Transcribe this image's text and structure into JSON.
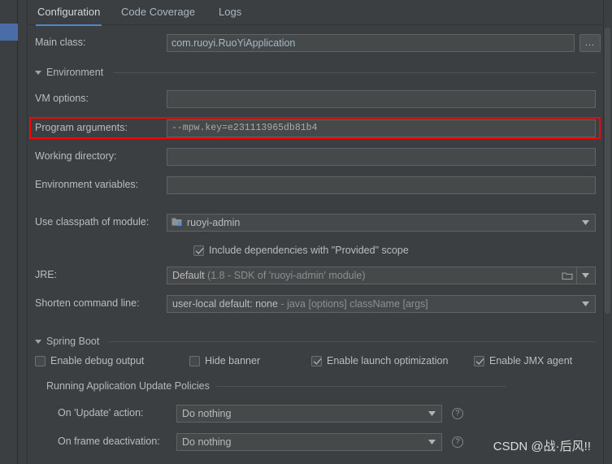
{
  "window": {
    "background": "#3c3f41",
    "accent": "#4a88c7",
    "highlight_color": "#ff0000"
  },
  "tabs": [
    {
      "label": "Configuration",
      "active": true
    },
    {
      "label": "Code Coverage",
      "active": false
    },
    {
      "label": "Logs",
      "active": false
    }
  ],
  "fields": {
    "main_class": {
      "label": "Main class:",
      "value": "com.ruoyi.RuoYiApplication",
      "browse_label": "..."
    },
    "vm_options": {
      "label": "VM options:",
      "value": "",
      "icons": [
        "plus-icon",
        "expand-icon"
      ]
    },
    "program_arguments": {
      "label": "Program arguments:",
      "value": "--mpw.key=e231113965db81b4",
      "icons": [
        "plus-icon",
        "expand-icon"
      ],
      "highlighted": true
    },
    "working_directory": {
      "label": "Working directory:",
      "value": "",
      "icons": [
        "plus-icon",
        "folder-icon"
      ]
    },
    "environment_variables": {
      "label": "Environment variables:",
      "value": "",
      "icons": [
        "list-icon"
      ]
    },
    "use_classpath_of_module": {
      "label": "Use classpath of module:",
      "value": "ruoyi-admin",
      "icon": "module-icon"
    },
    "jre": {
      "label": "JRE:",
      "value": "Default",
      "value_hint": "(1.8 - SDK of 'ruoyi-admin' module)"
    },
    "shorten_command_line": {
      "label": "Shorten command line:",
      "value": "user-local default: none",
      "value_hint": "- java [options] className [args]"
    }
  },
  "sections": {
    "environment": {
      "label": "Environment",
      "expanded": true
    },
    "spring_boot": {
      "label": "Spring Boot",
      "expanded": true
    },
    "running_application_update_policies": {
      "label": "Running Application Update Policies"
    }
  },
  "checkboxes": {
    "include_provided_scope": {
      "label": "Include dependencies with \"Provided\" scope",
      "checked": true
    },
    "enable_debug_output": {
      "label": "Enable debug output",
      "checked": false
    },
    "hide_banner": {
      "label": "Hide banner",
      "checked": false
    },
    "enable_launch_optimization": {
      "label": "Enable launch optimization",
      "checked": true
    },
    "enable_jmx_agent": {
      "label": "Enable JMX agent",
      "checked": true
    }
  },
  "update_policies": {
    "on_update_action": {
      "label": "On 'Update' action:",
      "value": "Do nothing",
      "help": "?"
    },
    "on_frame_deactivation": {
      "label": "On frame deactivation:",
      "value": "Do nothing",
      "help": "?"
    }
  },
  "watermark": {
    "text": "CSDN @战·后风!!"
  }
}
